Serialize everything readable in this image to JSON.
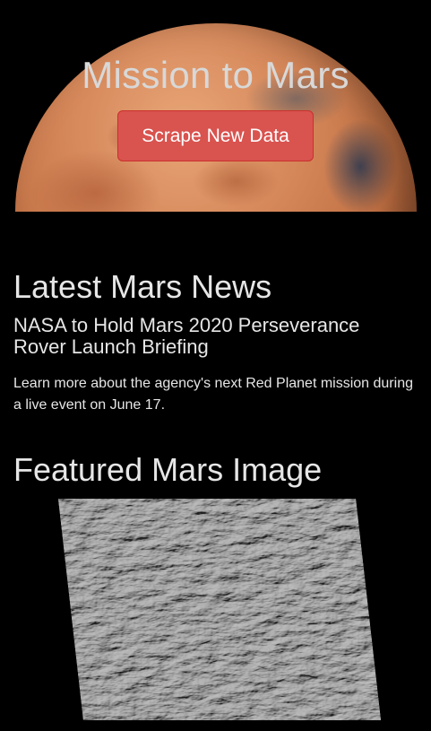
{
  "hero": {
    "title": "Mission to Mars",
    "button_label": "Scrape New Data",
    "button_color": "#d9534f"
  },
  "news": {
    "section_title": "Latest Mars News",
    "headline": "NASA to Hold Mars 2020 Perseverance Rover Launch Briefing",
    "teaser": "Learn more about the agency's next Red Planet mission during a live event on June 17."
  },
  "featured_image": {
    "section_title": "Featured Mars Image"
  },
  "colors": {
    "background": "#000000",
    "text": "#e6e6e6"
  }
}
